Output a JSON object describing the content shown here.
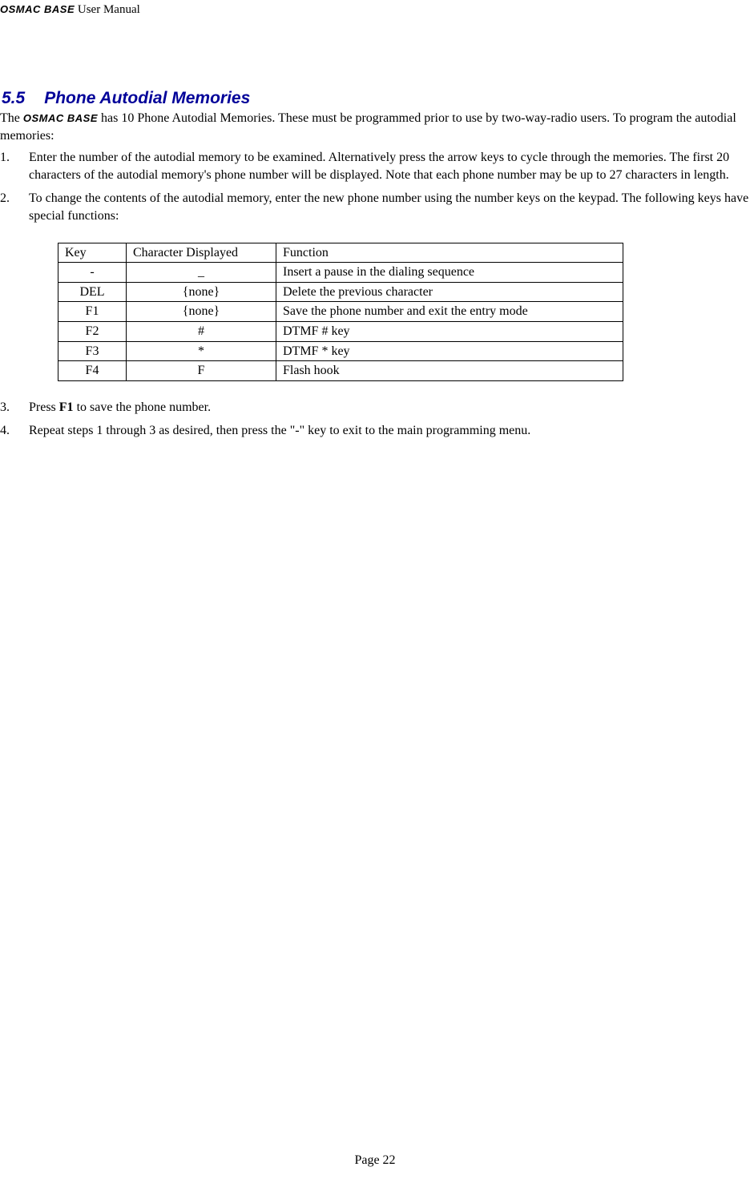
{
  "header": {
    "brand": "OSMAC BASE",
    "rest": " User Manual"
  },
  "section": {
    "number": "5.5",
    "title": "Phone Autodial Memories"
  },
  "intro": {
    "pre": "The ",
    "brand": "OSMAC BASE",
    "post": " has 10 Phone Autodial Memories.  These must be programmed prior to use by two-way-radio users.  To program the autodial memories:"
  },
  "steps": {
    "s1": {
      "num": "1.",
      "text": "Enter the number of the autodial memory to be examined.  Alternatively press the arrow keys to cycle through the memories.  The first 20 characters of the autodial memory's phone number will be displayed.  Note that each phone number may be up to 27 characters in length."
    },
    "s2": {
      "num": "2.",
      "text": "To change the contents of the autodial memory, enter the new phone number using the number keys on the keypad.  The following keys have special functions:"
    },
    "s3": {
      "num": "3.",
      "pre": "Press ",
      "bold": "F1",
      "post": " to save the phone number."
    },
    "s4": {
      "num": "4.",
      "text": "Repeat steps 1 through 3 as desired, then press the \"-\" key to exit to the main programming menu."
    }
  },
  "table": {
    "head": {
      "c1": "Key",
      "c2": "Character Displayed",
      "c3": "Function"
    },
    "rows": [
      {
        "c1": "-",
        "c2": "_",
        "c3": "Insert a pause in the dialing sequence"
      },
      {
        "c1": "DEL",
        "c2": "{none}",
        "c3": "Delete the previous character"
      },
      {
        "c1": "F1",
        "c2": "{none}",
        "c3": "Save the phone number and exit the entry mode"
      },
      {
        "c1": "F2",
        "c2": "#",
        "c3": "DTMF # key"
      },
      {
        "c1": "F3",
        "c2": "*",
        "c3": "DTMF * key"
      },
      {
        "c1": "F4",
        "c2": "F",
        "c3": "Flash hook"
      }
    ]
  },
  "footer": "Page 22"
}
